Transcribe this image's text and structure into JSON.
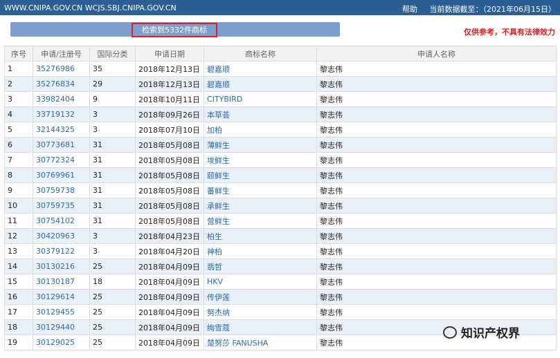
{
  "topbar": {
    "sites": "WWW.CNIPA.GOV.CN WCJS.SBJ.CNIPA.GOV.CN",
    "help": "帮助",
    "data_date": "当前数据截至：（2021年06月15日）"
  },
  "search": {
    "result_count": "检索到5332件商标",
    "disclaimer": "仅供参考，不具有法律效力"
  },
  "table": {
    "headers": [
      "序号",
      "申请/注册号",
      "国际分类",
      "申请日期",
      "商标名称",
      "申请人名称"
    ],
    "rows": [
      {
        "no": "1",
        "regno": "35276986",
        "cls": "35",
        "date": "2018年12月13日",
        "name": "碧嘉顺",
        "applicant": "黎志伟"
      },
      {
        "no": "2",
        "regno": "35276834",
        "cls": "29",
        "date": "2018年12月13日",
        "name": "碧嘉顺",
        "applicant": "黎志伟"
      },
      {
        "no": "3",
        "regno": "33982404",
        "cls": "9",
        "date": "2018年10月11日",
        "name": "CITYBIRD",
        "applicant": "黎志伟"
      },
      {
        "no": "4",
        "regno": "33719132",
        "cls": "3",
        "date": "2018年09月26日",
        "name": "本草荟",
        "applicant": "黎志伟"
      },
      {
        "no": "5",
        "regno": "32144325",
        "cls": "3",
        "date": "2018年07月10日",
        "name": "加柏",
        "applicant": "黎志伟"
      },
      {
        "no": "6",
        "regno": "30773681",
        "cls": "31",
        "date": "2018年05月08日",
        "name": "薄鲜生",
        "applicant": "黎志伟"
      },
      {
        "no": "7",
        "regno": "30772324",
        "cls": "31",
        "date": "2018年05月08日",
        "name": "埃鲜生",
        "applicant": "黎志伟"
      },
      {
        "no": "8",
        "regno": "30769961",
        "cls": "31",
        "date": "2018年05月08日",
        "name": "颐鲜生",
        "applicant": "黎志伟"
      },
      {
        "no": "9",
        "regno": "30759738",
        "cls": "31",
        "date": "2018年05月08日",
        "name": "蕃鲜生",
        "applicant": "黎志伟"
      },
      {
        "no": "10",
        "regno": "30759735",
        "cls": "31",
        "date": "2018年05月08日",
        "name": "承鲜生",
        "applicant": "黎志伟"
      },
      {
        "no": "11",
        "regno": "30754102",
        "cls": "31",
        "date": "2018年05月08日",
        "name": "营鲜生",
        "applicant": "黎志伟"
      },
      {
        "no": "12",
        "regno": "30420963",
        "cls": "3",
        "date": "2018年04月23日",
        "name": "柏生",
        "applicant": "黎志伟"
      },
      {
        "no": "13",
        "regno": "30379122",
        "cls": "3",
        "date": "2018年04月20日",
        "name": "神柏",
        "applicant": "黎志伟"
      },
      {
        "no": "14",
        "regno": "30130216",
        "cls": "25",
        "date": "2018年04月09日",
        "name": "翡哲",
        "applicant": "黎志伟"
      },
      {
        "no": "15",
        "regno": "30130187",
        "cls": "18",
        "date": "2018年04月09日",
        "name": "HKV",
        "applicant": "黎志伟"
      },
      {
        "no": "16",
        "regno": "30129614",
        "cls": "25",
        "date": "2018年04月09日",
        "name": "传伊莲",
        "applicant": "黎志伟"
      },
      {
        "no": "17",
        "regno": "30129455",
        "cls": "25",
        "date": "2018年04月09日",
        "name": "努杰纳",
        "applicant": "黎志伟"
      },
      {
        "no": "18",
        "regno": "30129440",
        "cls": "25",
        "date": "2018年04月09日",
        "name": "绚雪蔻",
        "applicant": "黎志伟"
      },
      {
        "no": "19",
        "regno": "30129025",
        "cls": "25",
        "date": "2018年04月09日",
        "name": "楚努莎 FANUSHA",
        "applicant": "黎志伟"
      }
    ]
  },
  "watermark": {
    "icon": "wechat-icon",
    "text": "知识产权界"
  }
}
